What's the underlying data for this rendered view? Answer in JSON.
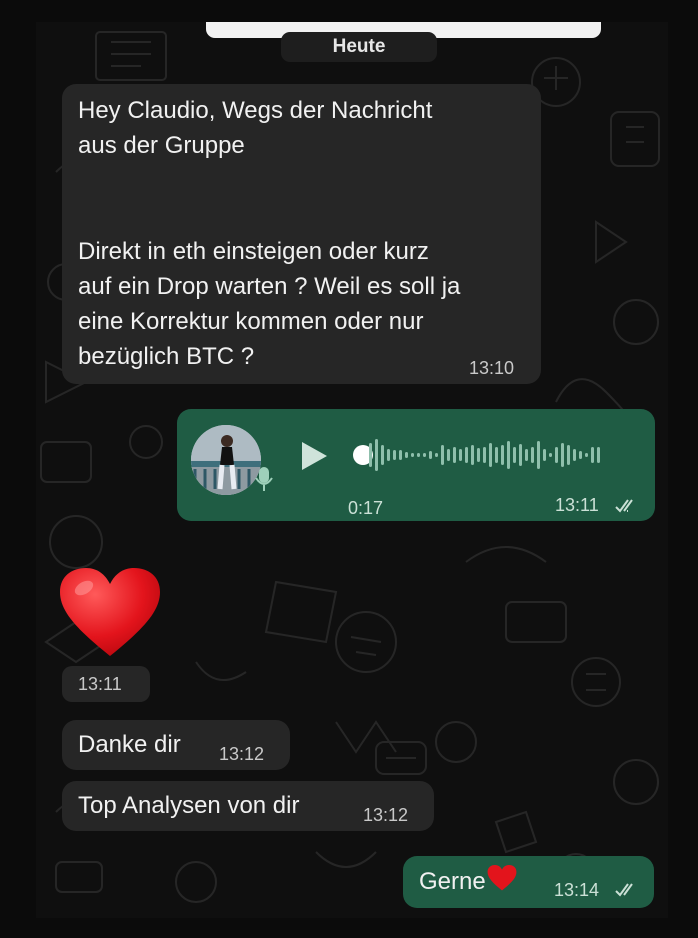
{
  "date_divider": "Heute",
  "messages": {
    "m1": {
      "line1": "Hey Claudio, Wegs der Nachricht",
      "line2": "aus der Gruppe",
      "line3": "Direkt in eth einsteigen oder kurz",
      "line4": "auf ein Drop warten ? Weil es soll ja",
      "line5": "eine Korrektur kommen oder nur",
      "line6": "bezüglich BTC ?",
      "time": "13:10"
    },
    "voice": {
      "duration": "0:17",
      "time": "13:11",
      "status": "read"
    },
    "heart": {
      "emoji_icon": "red-heart-icon",
      "time": "13:11"
    },
    "m3": {
      "text": "Danke dir",
      "time": "13:12"
    },
    "m4": {
      "text": "Top Analysen von dir",
      "time": "13:12"
    },
    "m5": {
      "text": "Gerne",
      "time": "13:14",
      "status": "read"
    }
  },
  "colors": {
    "incoming_bubble": "#262626",
    "outgoing_bubble": "#1f5c44",
    "background": "#0f0f0f"
  }
}
